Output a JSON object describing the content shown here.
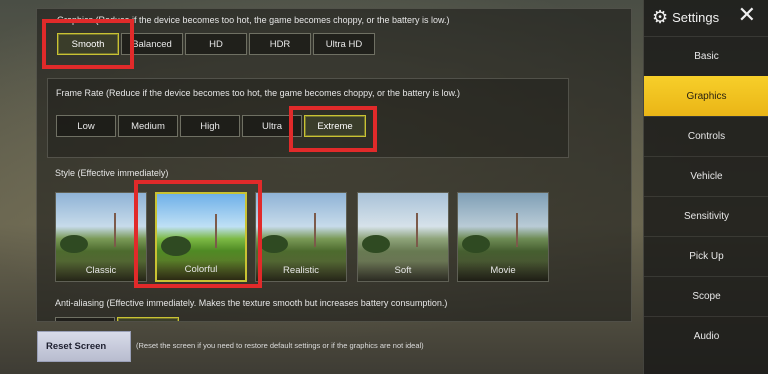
{
  "header": {
    "title": "Settings",
    "close_label": "✕",
    "gear_glyph": "⚙"
  },
  "sidebar": {
    "items": [
      {
        "label": "Basic",
        "active": false
      },
      {
        "label": "Graphics",
        "active": true
      },
      {
        "label": "Controls",
        "active": false
      },
      {
        "label": "Vehicle",
        "active": false
      },
      {
        "label": "Sensitivity",
        "active": false
      },
      {
        "label": "Pick Up",
        "active": false
      },
      {
        "label": "Scope",
        "active": false
      },
      {
        "label": "Audio",
        "active": false
      }
    ]
  },
  "graphics": {
    "label": "Graphics (Reduce if the device becomes too hot, the game becomes choppy, or the battery is low.)",
    "options": [
      "Smooth",
      "Balanced",
      "HD",
      "HDR",
      "Ultra HD"
    ],
    "selected": "Smooth"
  },
  "frame_rate": {
    "label": "Frame Rate (Reduce if the device becomes too hot, the game becomes choppy, or the battery is low.)",
    "options": [
      "Low",
      "Medium",
      "High",
      "Ultra",
      "Extreme"
    ],
    "selected": "Extreme"
  },
  "style": {
    "label": "Style (Effective immediately)",
    "options": [
      "Classic",
      "Colorful",
      "Realistic",
      "Soft",
      "Movie"
    ],
    "selected": "Colorful"
  },
  "anti_aliasing": {
    "label": "Anti-aliasing (Effective immediately. Makes the texture smooth but increases battery consumption.)"
  },
  "footer": {
    "reset_label": "Reset Screen",
    "reset_note": "(Reset the screen if you need to restore default settings or if the graphics are not ideal)"
  },
  "colors": {
    "accent_yellow": "#f2c21f",
    "highlight_red": "#e12a2a",
    "selected_border": "#c9c233"
  }
}
